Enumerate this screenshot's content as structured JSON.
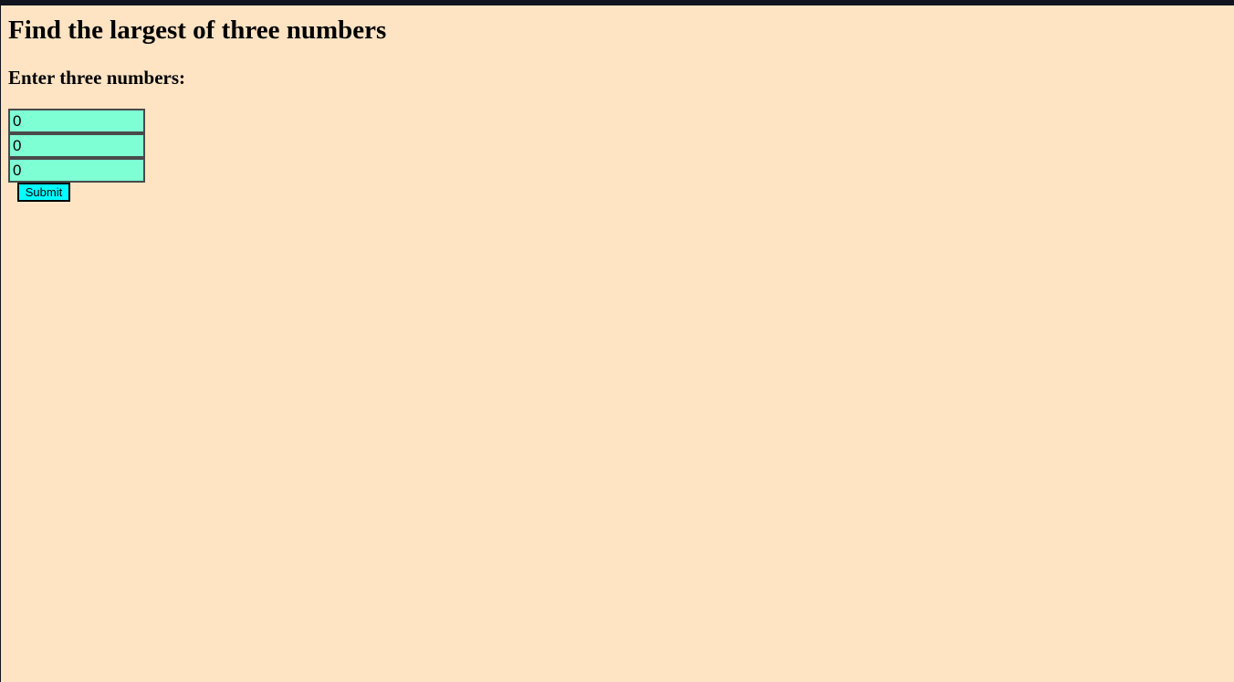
{
  "page": {
    "title": "Find the largest of three numbers",
    "subtitle": "Enter three numbers:"
  },
  "form": {
    "fields": [
      {
        "value": "0"
      },
      {
        "value": "0"
      },
      {
        "value": "0"
      }
    ],
    "submit_label": "Submit"
  },
  "colors": {
    "page_background": "#ffe4c4",
    "input_background": "#7fffd4",
    "button_background": "#00ffff",
    "top_bar": "#11131f"
  }
}
